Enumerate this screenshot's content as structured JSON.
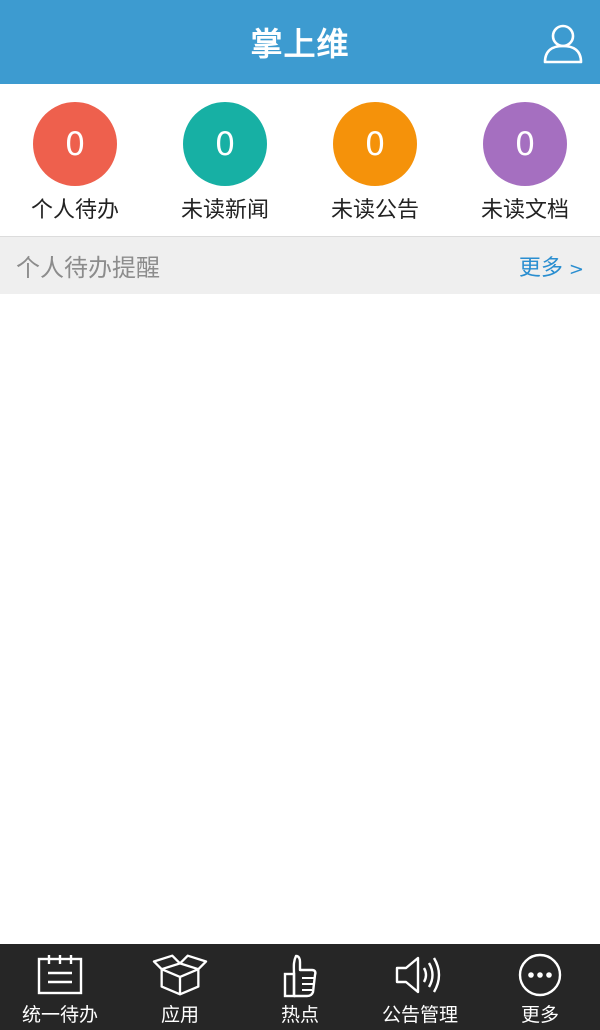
{
  "header": {
    "title": "掌上维",
    "user_icon": "user-icon"
  },
  "stats": [
    {
      "count": "0",
      "label": "个人待办",
      "color": "#ee604d"
    },
    {
      "count": "0",
      "label": "未读新闻",
      "color": "#17b0a4"
    },
    {
      "count": "0",
      "label": "未读公告",
      "color": "#f5920a"
    },
    {
      "count": "0",
      "label": "未读文档",
      "color": "#a56fc0"
    }
  ],
  "section": {
    "title": "个人待办提醒",
    "more_label": "更多",
    "more_arrow": ">"
  },
  "tabbar": {
    "items": [
      {
        "label": "统一待办",
        "icon": "calendar-icon"
      },
      {
        "label": "应用",
        "icon": "box-icon"
      },
      {
        "label": "热点",
        "icon": "thumbs-up-icon"
      },
      {
        "label": "公告管理",
        "icon": "speaker-icon"
      },
      {
        "label": "更多",
        "icon": "more-icon"
      }
    ]
  }
}
